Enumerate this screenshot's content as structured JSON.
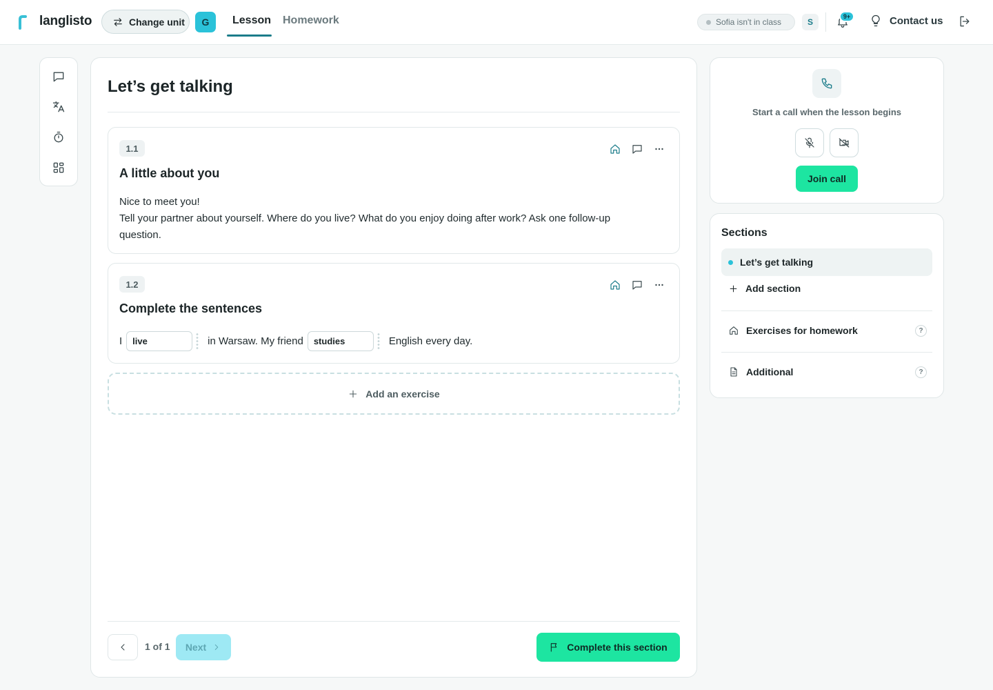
{
  "header": {
    "brand": "langlisto",
    "change_unit_label": "Change unit",
    "group_badge": "G",
    "tabs": [
      {
        "label": "Lesson",
        "active": true
      },
      {
        "label": "Homework",
        "active": false
      }
    ],
    "student_status": "Sofia isn't in class",
    "student_avatar": "S",
    "notifications_badge": "9+",
    "contact_label": "Contact us",
    "icons": [
      "swap-arrows-icon",
      "bell-icon",
      "lightbulb-icon",
      "logout-icon"
    ]
  },
  "toolbar": {
    "icons": [
      "chat-icon",
      "translate-icon",
      "timer-icon",
      "apps-icon"
    ]
  },
  "lesson": {
    "title": "Let’s get talking",
    "exercises": [
      {
        "number": "1.1",
        "title": "A little about you",
        "lines": [
          "Nice to meet you!",
          "Tell your partner about yourself. Where do you live? What do you enjoy doing after work? Ask one follow-up question."
        ]
      },
      {
        "number": "1.2",
        "title": "Complete the sentences",
        "sentence": {
          "part1": "I",
          "gap1": "live",
          "part2": "in Warsaw. My friend",
          "gap2": "studies",
          "part3": "English every day."
        }
      }
    ],
    "add_exercise_label": "Add an exercise",
    "pagination": {
      "text": "1 of 1",
      "next_label": "Next"
    },
    "complete_label": "Complete this section"
  },
  "call": {
    "hint": "Start a call when the lesson begins",
    "join_label": "Join call"
  },
  "sections": {
    "title": "Sections",
    "items": [
      {
        "label": "Let’s get talking",
        "active": true
      }
    ],
    "add_label": "Add section",
    "extras": [
      {
        "label": "Exercises for homework",
        "help": "?"
      },
      {
        "label": "Additional",
        "help": "?"
      }
    ]
  },
  "colors": {
    "accent_teal": "#1b7c8a",
    "brand_cyan": "#2bc2d9",
    "action_green": "#1de5a1",
    "next_disabled": "#9ee9f4"
  }
}
